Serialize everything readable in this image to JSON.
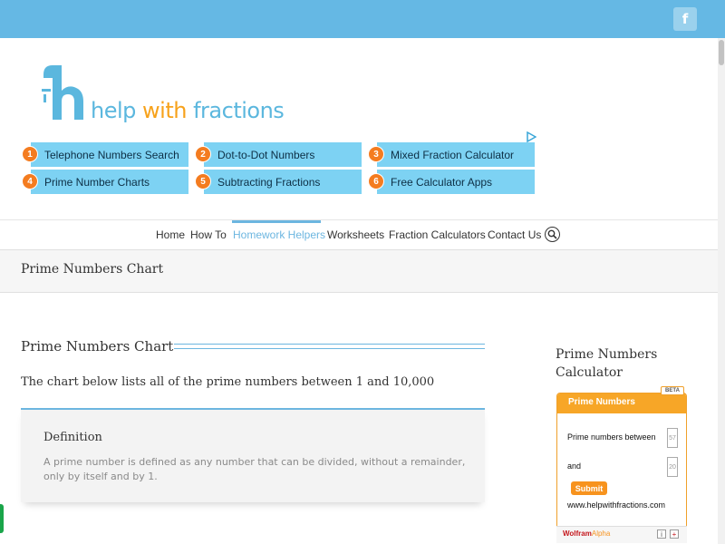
{
  "header": {
    "facebook_label": "f"
  },
  "logo": {
    "word1": "help",
    "word2": "with",
    "word3": "fractions"
  },
  "ads": {
    "links": [
      {
        "num": "1",
        "label": "Telephone Numbers Search"
      },
      {
        "num": "2",
        "label": "Dot-to-Dot Numbers"
      },
      {
        "num": "3",
        "label": "Mixed Fraction Calculator"
      },
      {
        "num": "4",
        "label": "Prime Number Charts"
      },
      {
        "num": "5",
        "label": "Subtracting Fractions"
      },
      {
        "num": "6",
        "label": "Free Calculator Apps"
      }
    ]
  },
  "nav": {
    "items": [
      "Home",
      "How To",
      "Homework Helpers",
      "Worksheets",
      "Fraction Calculators",
      "Contact Us"
    ],
    "active": "Homework Helpers"
  },
  "page": {
    "title_bar": "Prime Numbers Chart",
    "heading": "Prime Numbers Chart",
    "subheading": "The chart below lists all of the prime numbers between 1 and 10,000",
    "definition_title": "Definition",
    "definition_text": "A prime number is defined as any number that can be divided, without a remainder, only by itself and by 1."
  },
  "sidebar": {
    "title": "Prime Numbers Calculator",
    "widget": {
      "header": "Prime Numbers",
      "badge": "BETA",
      "label_between": "Prime numbers between",
      "value1": "57",
      "label_and": "and",
      "value2": "20",
      "submit": "Submit",
      "site": "www.helpwithfractions.com",
      "footer_brand_a": "Wolfram",
      "footer_brand_b": "Alpha",
      "info_icon": "i",
      "add_icon": "+"
    }
  },
  "colors": {
    "topbar": "#65b8e4",
    "accent": "#6cb6e0",
    "ad_bg": "#7dd2f3",
    "ad_number": "#f47c20",
    "widget_orange": "#f7a627"
  }
}
